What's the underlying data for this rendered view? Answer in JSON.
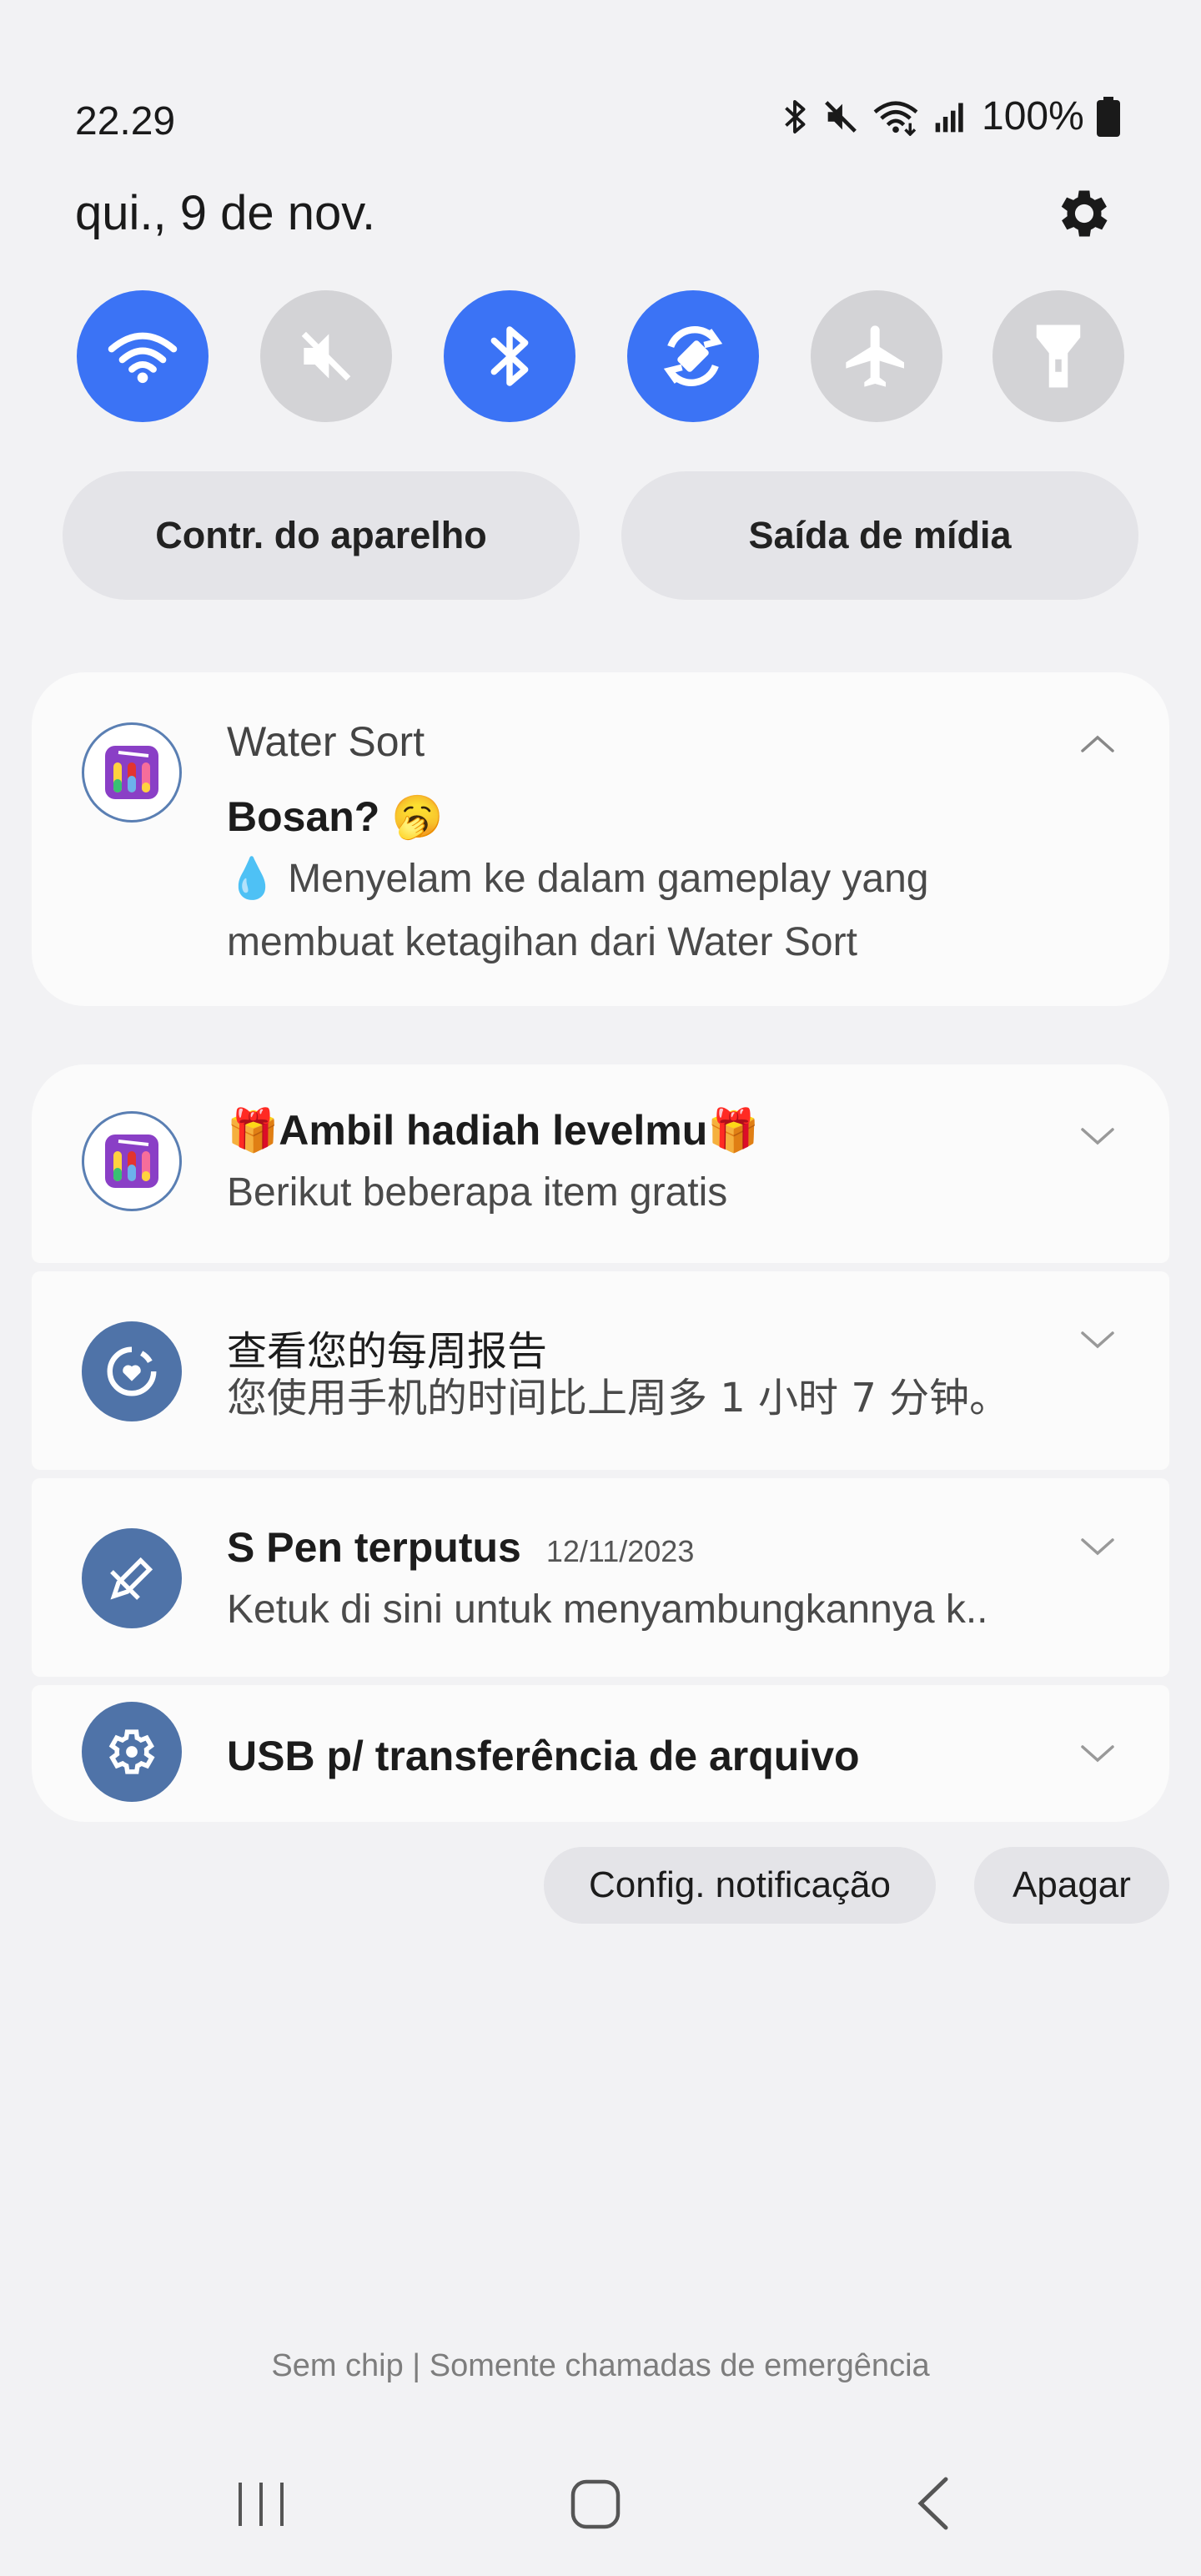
{
  "status_bar": {
    "time": "22.29",
    "battery": "100%"
  },
  "panel": {
    "date": "qui., 9 de nov.",
    "settings_icon": "gear-icon",
    "accent_color": "#3b73f5"
  },
  "quick_toggles": [
    {
      "name": "wifi",
      "icon": "wifi-icon",
      "state": "on"
    },
    {
      "name": "sound",
      "icon": "mute-icon",
      "state": "off"
    },
    {
      "name": "bluetooth",
      "icon": "bluetooth-icon",
      "state": "on"
    },
    {
      "name": "auto-rotate",
      "icon": "rotate-icon",
      "state": "on"
    },
    {
      "name": "airplane-mode",
      "icon": "airplane-icon",
      "state": "off"
    },
    {
      "name": "flashlight",
      "icon": "flashlight-icon",
      "state": "off"
    }
  ],
  "pills": {
    "device_control": "Contr. do aparelho",
    "media_output": "Saída de mídia"
  },
  "notifications": {
    "water_sort": {
      "app_name": "Water Sort",
      "title": "Bosan? 🥱",
      "body": "💧 Menyelam ke dalam gameplay yang membuat ketagihan dari Water Sort"
    },
    "level_reward": {
      "title": "🎁Ambil hadiah levelmu🎁",
      "body": "Berikut beberapa item gratis"
    },
    "weekly_report": {
      "title": "查看您的每周报告",
      "body": "您使用手机的时间比上周多 1 小时 7 分钟。"
    },
    "s_pen": {
      "title": "S Pen terputus",
      "date": "12/11/2023",
      "body": "Ketuk di sini untuk menyambungkannya k.."
    },
    "usb": {
      "title": "USB p/ transferência de arquivo"
    }
  },
  "actions": {
    "notification_settings": "Config. notificação",
    "clear": "Apagar"
  },
  "footer": {
    "carrier_text": "Sem chip | Somente chamadas de emergência"
  },
  "nav_bar": {
    "recents": "recents-icon",
    "home": "home-icon",
    "back": "back-icon"
  }
}
